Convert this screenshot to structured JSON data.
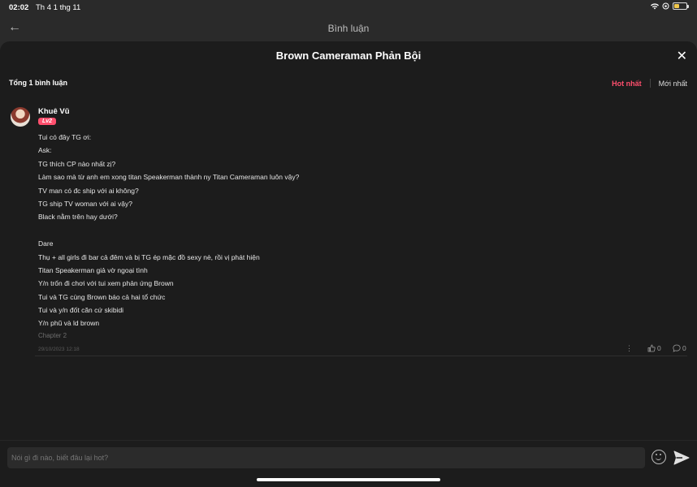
{
  "status_bar": {
    "time": "02:02",
    "date": "Th 4 1 thg 11"
  },
  "top_bar": {
    "title": "Bình luận"
  },
  "sheet": {
    "title": "Brown Cameraman Phản Bội"
  },
  "summary": {
    "total": "Tổng 1 bình luận"
  },
  "sort": {
    "hot": "Hot nhất",
    "new": "Mới nhất"
  },
  "comment": {
    "author": "Khuê Vũ",
    "level": "Lv2",
    "lines": [
      "Tui có đây TG ơi:",
      "Ask:",
      "TG thích CP nào nhất zị?",
      "Làm sao mà từ anh em xong titan Speakerman thành ny Titan Cameraman luôn vậy?",
      "TV man có đc ship với ai không?",
      "TG ship TV woman với ai vậy?",
      "Black nằm trên hay dưới?",
      "",
      "Dare",
      "Thụ + all girls đi bar cả đêm và bị TG ép mặc đồ sexy nè, rồi vị phát hiện",
      "Titan Speakerman giả vờ ngoại tình",
      "Y/n trốn đi chơi với tui xem phản ứng Brown",
      "Tui và TG cùng Brown báo cả hai tổ chức",
      "Tui và y/n đốt căn cứ skibidi",
      "Y/n phũ và ld brown"
    ],
    "chapter": "Chapter 2",
    "timestamp": "29/10/2023 12:18",
    "likes": "0",
    "replies": "0"
  },
  "composer": {
    "placeholder": "Nói gì đi nào, biết đâu lại hot?"
  }
}
